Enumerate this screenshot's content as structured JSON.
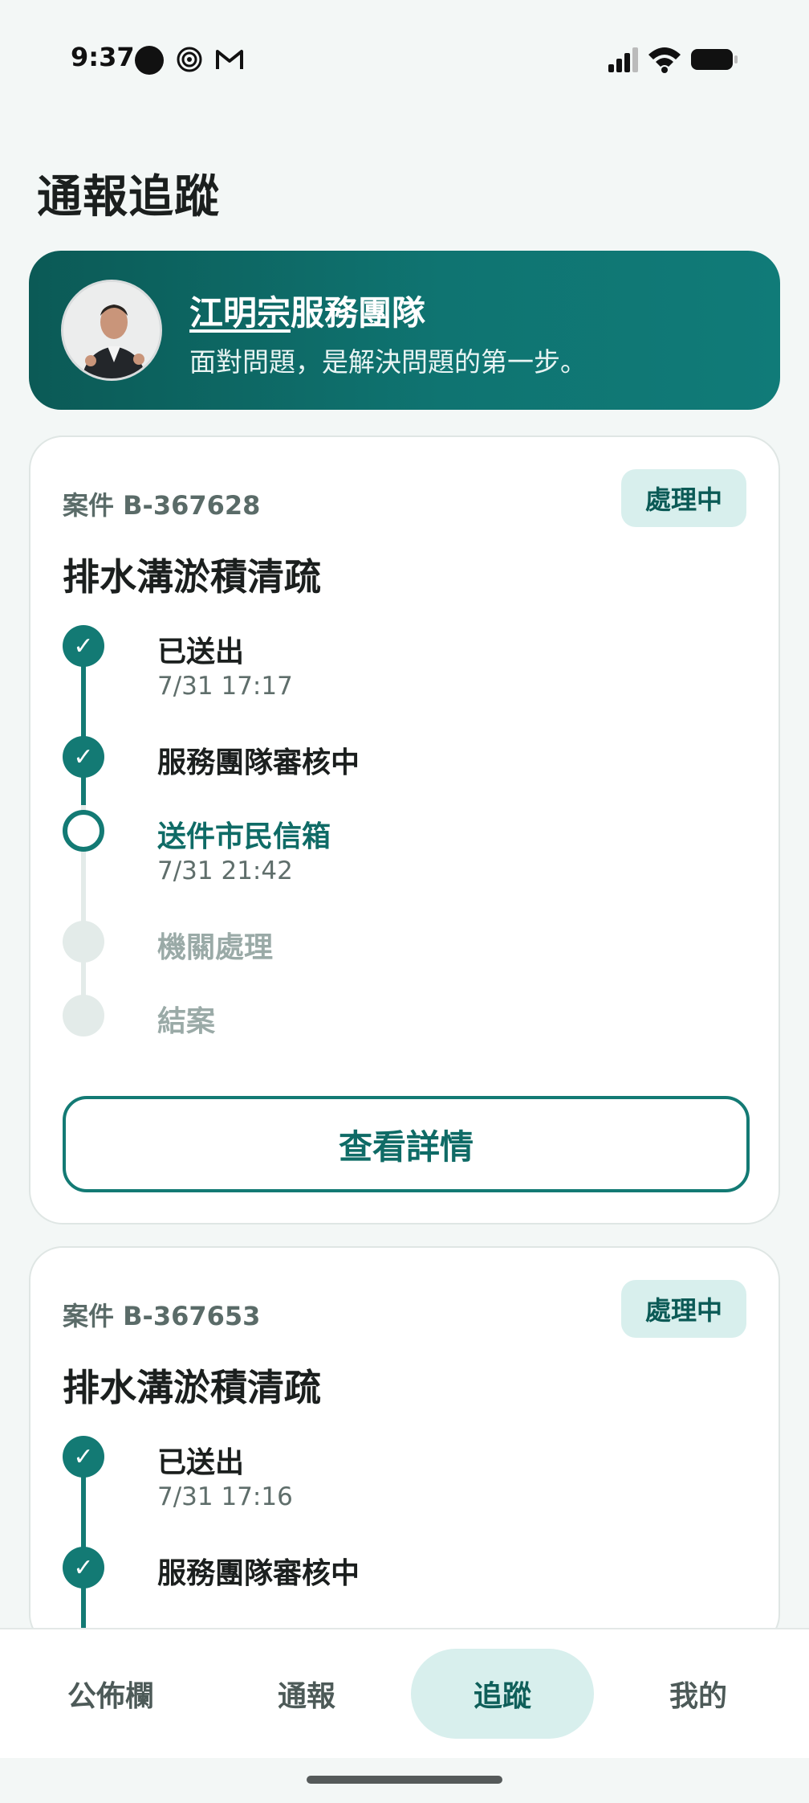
{
  "status_bar": {
    "time": "9:37"
  },
  "page_title": "通報追蹤",
  "banner": {
    "title_underlined": "江明宗",
    "title_rest": "服務團隊",
    "subtitle": "面對問題，是解決問題的第一步。"
  },
  "cases": [
    {
      "id": "案件 B-367628",
      "status": "處理中",
      "title": "排水溝淤積清疏",
      "steps": [
        {
          "label": "已送出",
          "time": "7/31 17:17",
          "state": "done"
        },
        {
          "label": "服務團隊審核中",
          "time": "",
          "state": "done"
        },
        {
          "label": "送件市民信箱",
          "time": "7/31 21:42",
          "state": "current"
        },
        {
          "label": "機關處理",
          "time": "",
          "state": "todo"
        },
        {
          "label": "結案",
          "time": "",
          "state": "todo"
        }
      ],
      "details_label": "查看詳情"
    },
    {
      "id": "案件 B-367653",
      "status": "處理中",
      "title": "排水溝淤積清疏",
      "steps": [
        {
          "label": "已送出",
          "time": "7/31 17:16",
          "state": "done"
        },
        {
          "label": "服務團隊審核中",
          "time": "",
          "state": "done"
        }
      ]
    }
  ],
  "check_glyph": "✓",
  "nav": {
    "items": [
      "公佈欄",
      "通報",
      "追蹤",
      "我的"
    ],
    "active_index": 2
  },
  "colors": {
    "accent": "#137a74",
    "accent_light": "#d8efed",
    "banner": "#0f7471"
  }
}
